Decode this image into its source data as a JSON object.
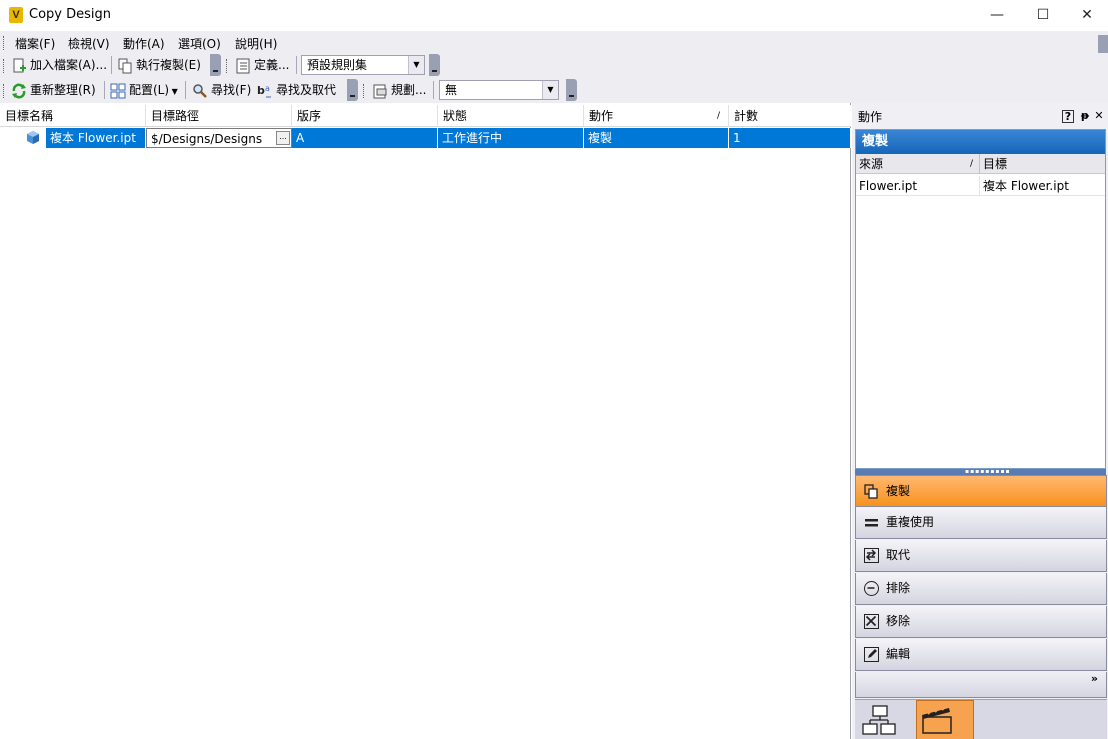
{
  "window": {
    "title": "Copy Design",
    "icon_letter": "V",
    "min_glyph": "—",
    "max_glyph": "☐",
    "close_glyph": "✕"
  },
  "menu": [
    "檔案(F)",
    "檢視(V)",
    "動作(A)",
    "選項(O)",
    "說明(H)"
  ],
  "toolbar1": {
    "add_files": "加入檔案(A)...",
    "run_copy": "執行複製(E)",
    "define": "定義...",
    "ruleset_value": "預設規則集"
  },
  "toolbar2": {
    "refresh": "重新整理(R)",
    "layout": "配置(L)",
    "find": "尋找(F)",
    "find_replace": "尋找及取代",
    "rules": "規劃...",
    "filter_value": "無"
  },
  "grid": {
    "columns": [
      "目標名稱",
      "目標路徑",
      "版序",
      "狀態",
      "動作",
      "計數"
    ],
    "rows": [
      {
        "name": "複本 Flower.ipt",
        "path": "$/Designs/Designs",
        "revision": "A",
        "state": "工作進行中",
        "action": "複製",
        "count": "1"
      }
    ],
    "ellipsis": "..."
  },
  "panel": {
    "title": "動作",
    "help_glyph": "?",
    "pin_glyph": "ᵽ",
    "close_glyph": "✕",
    "header": "複製",
    "columns": [
      "來源",
      "目標"
    ],
    "sort_glyph": "/",
    "row": {
      "source": "Flower.ipt",
      "target": "複本 Flower.ipt"
    },
    "actions": [
      "複製",
      "重複使用",
      "取代",
      "排除",
      "移除",
      "編輯"
    ],
    "more_glyph": "»"
  },
  "colors": {
    "selection": "#0078d7",
    "active_action": "#f7921e",
    "panel_header": "#1565b8"
  },
  "icons": [
    "app-icon",
    "add-file-icon",
    "copy-run-icon",
    "define-icon",
    "refresh-icon",
    "layout-icon",
    "find-icon",
    "find-replace-icon",
    "rules-icon",
    "part-icon",
    "copy-icon",
    "reuse-icon",
    "replace-icon",
    "exclude-icon",
    "remove-icon",
    "edit-icon",
    "structure-tab-icon",
    "actions-tab-icon"
  ]
}
